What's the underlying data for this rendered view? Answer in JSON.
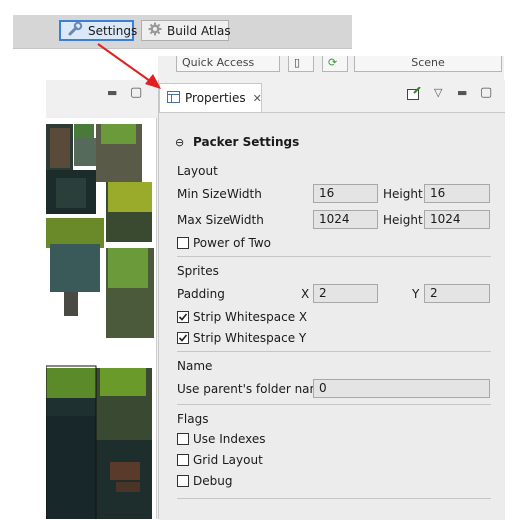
{
  "toolbar": {
    "settings_label": "Settings",
    "build_atlas_label": "Build Atlas"
  },
  "sub_toolbar": {
    "quick_access_label": "Quick Access",
    "scene_label": "Scene"
  },
  "properties": {
    "tab_title": "Properties",
    "section_title": "Packer Settings",
    "layout": {
      "heading": "Layout",
      "min_size_label": "Min Size",
      "max_size_label": "Max Size",
      "width_label": "Width",
      "height_label": "Height",
      "min_width": "16",
      "min_height": "16",
      "max_width": "1024",
      "max_height": "1024",
      "power_of_two_label": "Power of Two",
      "power_of_two_checked": false
    },
    "sprites": {
      "heading": "Sprites",
      "padding_label": "Padding",
      "x_label": "X",
      "y_label": "Y",
      "padding_x": "2",
      "padding_y": "2",
      "strip_x_label": "Strip Whitespace X",
      "strip_x_checked": true,
      "strip_y_label": "Strip Whitespace Y",
      "strip_y_checked": true
    },
    "name": {
      "heading": "Name",
      "parent_folder_label": "Use parent's folder name",
      "parent_folder_value": "0"
    },
    "flags": {
      "heading": "Flags",
      "use_indexes_label": "Use Indexes",
      "use_indexes_checked": false,
      "grid_layout_label": "Grid Layout",
      "grid_layout_checked": false,
      "debug_label": "Debug",
      "debug_checked": false
    }
  },
  "colors": {
    "accent": "#3c7fd6",
    "arrow": "#e02020"
  }
}
